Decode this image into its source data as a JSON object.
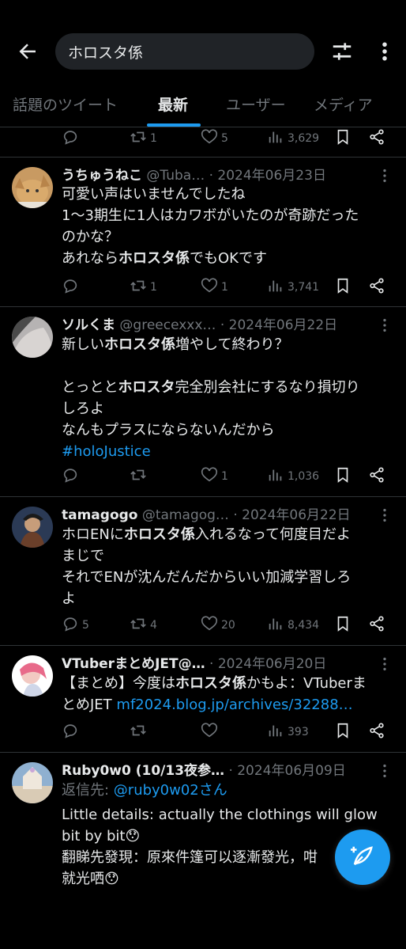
{
  "search": {
    "query": "ホロスタ係"
  },
  "tabs": [
    {
      "label": "話題のツイート"
    },
    {
      "label": "最新"
    },
    {
      "label": "ユーザー"
    },
    {
      "label": "メディア"
    }
  ],
  "top_actions": {
    "replies": "",
    "retweets": "1",
    "likes": "5",
    "views": "3,629"
  },
  "tweets": [
    {
      "name": "うちゅうねこ",
      "handle": "@Tuba…",
      "date": "· 2024年06月23日",
      "lines": [
        "可愛い声はいませんでしたね",
        "1〜3期生に1人はカワボがいたのが奇跡だった",
        "のかな？",
        "あれなら",
        "ホロスタ係",
        "でもOKです"
      ],
      "replies": "",
      "retweets": "1",
      "likes": "1",
      "views": "3,741"
    },
    {
      "name": "ソルくま",
      "handle": "@greecexxx…",
      "date": "· 2024年06月22日",
      "t1a": "新しい",
      "t1b": "ホロスタ係",
      "t1c": "増やして終わり？",
      "t2a": "とっとと",
      "t2b": "ホロスタ",
      "t2c": "完全別会社にするなり損切り",
      "t3": "しろよ",
      "t4": "なんもプラスにならないんだから",
      "hashtag": "#holoJustice",
      "replies": "",
      "retweets": "",
      "likes": "1",
      "views": "1,036"
    },
    {
      "name": "tamagogo",
      "handle": "@tamagog…",
      "date": "· 2024年06月22日",
      "t1a": "ホロENに",
      "t1b": "ホロスタ係",
      "t1c": "入れるなって何度目だよ",
      "t2": "まじで",
      "t3": "それでENが沈んだんだからいい加減学習しろ",
      "t4": "よ",
      "replies": "5",
      "retweets": "4",
      "likes": "20",
      "views": "8,434"
    },
    {
      "name": "VTuberまとめJET@…",
      "handle": "",
      "date": "· 2024年06月20日",
      "t1a": "【まとめ】今度は",
      "t1b": "ホロスタ係",
      "t1c": "かもよ：VTuberま",
      "t2a": "とめJET ",
      "link": "mf2024.blog.jp/archives/32288…",
      "replies": "",
      "retweets": "",
      "likes": "",
      "views": "393"
    },
    {
      "name": "Ruby0w0 (10/13夜参…",
      "handle": "",
      "date": "· 2024年06月09日",
      "reply_prefix": "返信先: ",
      "reply_to": "@ruby0w02さん",
      "t1": "Little details: actually the clothings will glow",
      "t2": "bit by bit😯",
      "t3": "翻睇先發現：原來件篷可以逐漸發光，咁",
      "t3b": "す",
      "t4": "就光哂😯"
    }
  ],
  "colors": {
    "accent": "#1d9bf0",
    "muted": "#71767b",
    "text": "#e7e9ea",
    "bg": "#000000"
  },
  "icons": [
    "back-arrow-icon",
    "tune-icon",
    "more-vertical-icon",
    "reply-icon",
    "retweet-icon",
    "like-icon",
    "views-icon",
    "bookmark-icon",
    "share-icon",
    "compose-icon"
  ]
}
